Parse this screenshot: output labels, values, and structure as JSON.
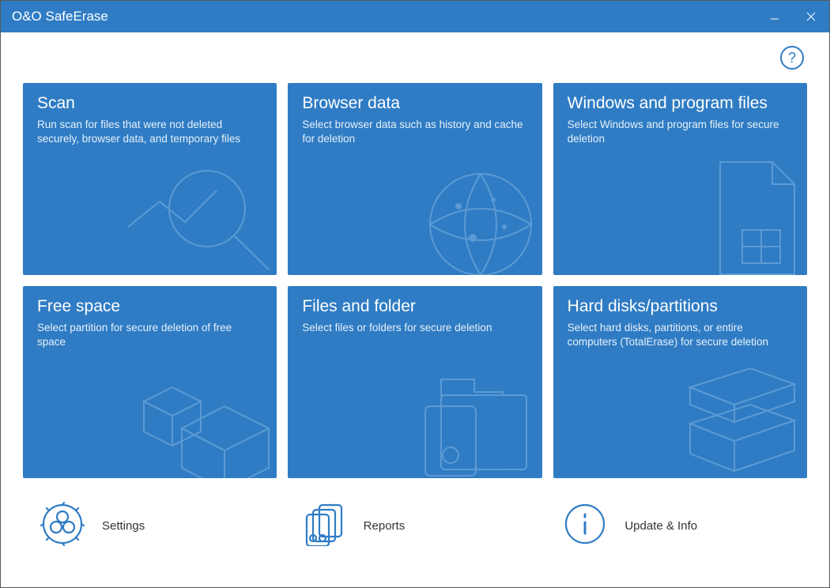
{
  "app": {
    "title": "O&O SafeErase"
  },
  "help": {
    "glyph": "?"
  },
  "cards": {
    "scan": {
      "title": "Scan",
      "desc": "Run scan for files that were not deleted securely, browser data, and temporary files"
    },
    "browser": {
      "title": "Browser data",
      "desc": "Select browser data such as history and cache for deletion"
    },
    "windows": {
      "title": "Windows and program files",
      "desc": "Select Windows and program files for secure deletion"
    },
    "free": {
      "title": "Free space",
      "desc": "Select partition for secure deletion of free space"
    },
    "files": {
      "title": "Files and folder",
      "desc": "Select files or folders for secure deletion"
    },
    "disks": {
      "title": "Hard disks/partitions",
      "desc": "Select hard disks, partitions, or entire computers (TotalErase) for secure deletion"
    }
  },
  "bottom": {
    "settings": "Settings",
    "reports": "Reports",
    "update": "Update & Info"
  }
}
